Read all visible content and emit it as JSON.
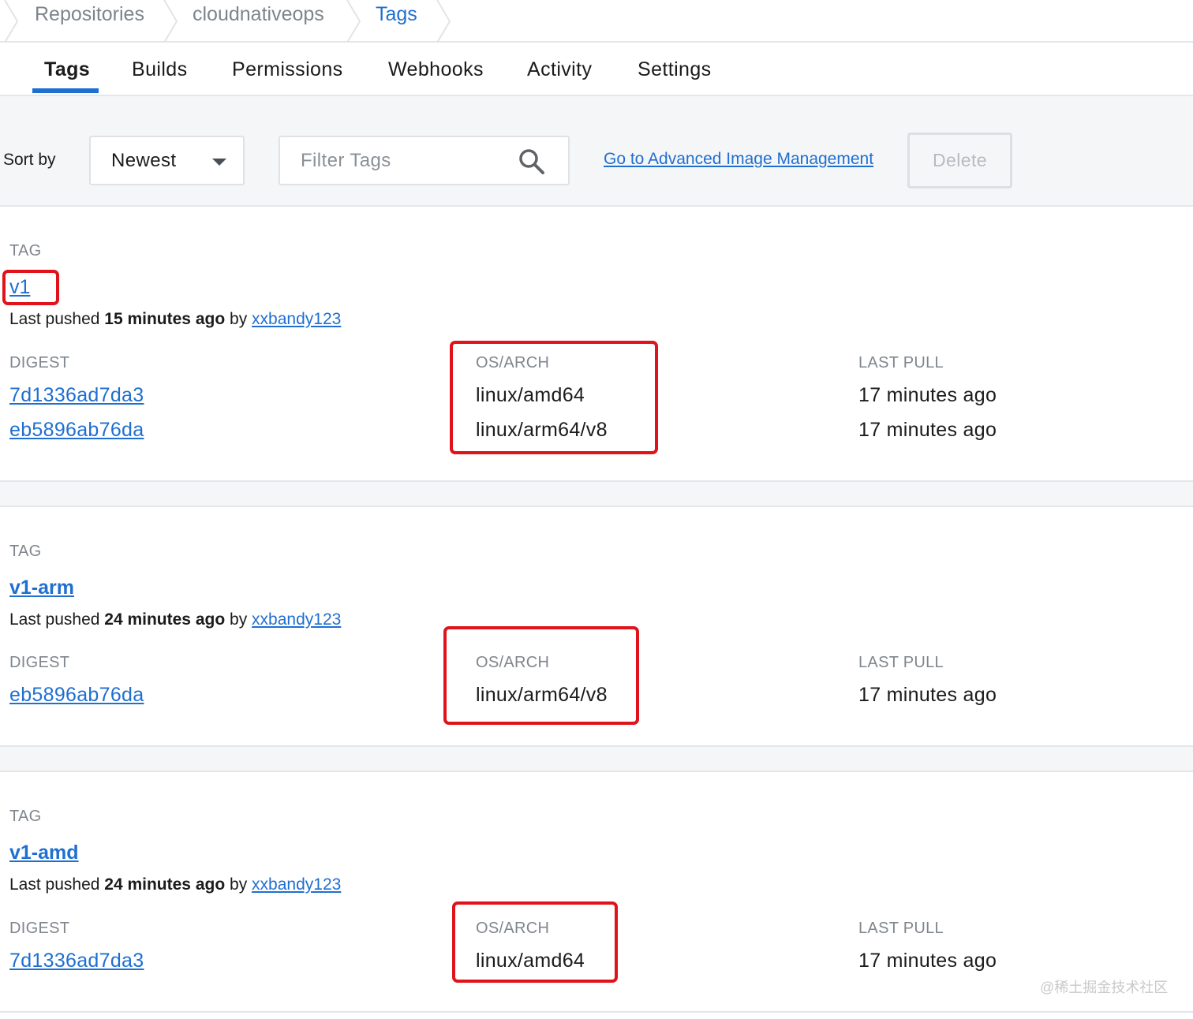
{
  "breadcrumb": {
    "items": [
      {
        "label": "Repositories"
      },
      {
        "label": "cloudnativeops"
      },
      {
        "label": "Tags"
      }
    ]
  },
  "tabs": [
    {
      "label": "Tags",
      "active": true
    },
    {
      "label": "Builds"
    },
    {
      "label": "Permissions"
    },
    {
      "label": "Webhooks"
    },
    {
      "label": "Activity"
    },
    {
      "label": "Settings"
    }
  ],
  "toolbar": {
    "sort_label": "Sort by",
    "sort_value": "Newest",
    "filter_placeholder": "Filter Tags",
    "filter_value": "",
    "advanced_link": "Go to Advanced Image Management",
    "delete_label": "Delete"
  },
  "columns": {
    "tag": "TAG",
    "digest": "DIGEST",
    "os_arch": "OS/ARCH",
    "last_pull": "LAST PULL"
  },
  "pushed_text": {
    "prefix": "Last pushed",
    "by": "by"
  },
  "tags": [
    {
      "name": "v1",
      "pushed_ago": "15 minutes ago",
      "pushed_by": "xxbandy123",
      "rows": [
        {
          "digest": "7d1336ad7da3",
          "os_arch": "linux/amd64",
          "last_pull": "17 minutes ago"
        },
        {
          "digest": "eb5896ab76da",
          "os_arch": "linux/arm64/v8",
          "last_pull": "17 minutes ago"
        }
      ]
    },
    {
      "name": "v1-arm",
      "pushed_ago": "24 minutes ago",
      "pushed_by": "xxbandy123",
      "rows": [
        {
          "digest": "eb5896ab76da",
          "os_arch": "linux/arm64/v8",
          "last_pull": "17 minutes ago"
        }
      ]
    },
    {
      "name": "v1-amd",
      "pushed_ago": "24 minutes ago",
      "pushed_by": "xxbandy123",
      "rows": [
        {
          "digest": "7d1336ad7da3",
          "os_arch": "linux/amd64",
          "last_pull": "17 minutes ago"
        }
      ]
    }
  ],
  "colors": {
    "link": "#1f6fd1",
    "highlight": "#e0131a",
    "panel": "#f5f6f7"
  },
  "watermark": "@稀土掘金技术社区"
}
